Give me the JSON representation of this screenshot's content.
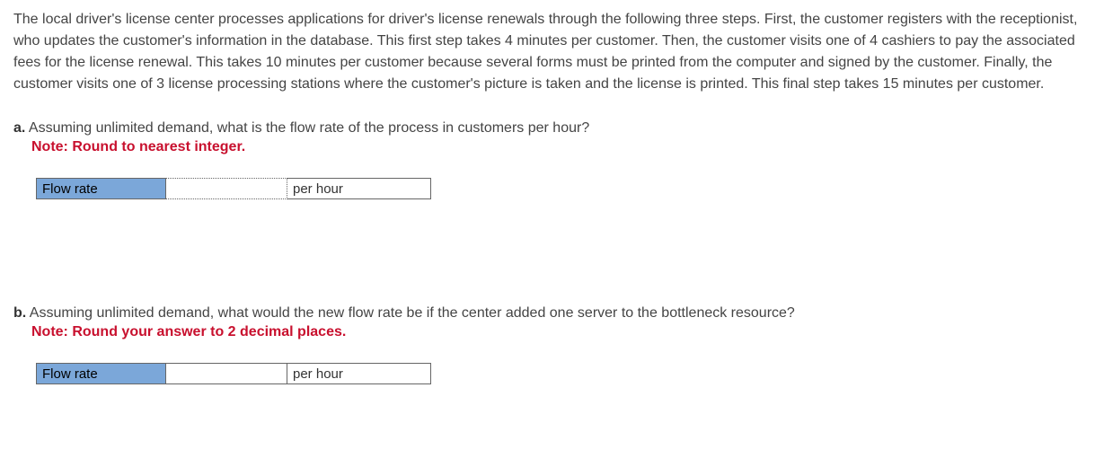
{
  "intro": "The local driver's license center processes applications for driver's license renewals through the following three steps. First, the customer registers with the receptionist, who updates the customer's information in the database. This first step takes 4 minutes per customer. Then, the customer visits one of 4 cashiers to pay the associated fees for the license renewal. This takes 10 minutes per customer because several forms must be printed from the computer and signed by the customer. Finally, the customer visits one of 3 license processing stations where the customer's picture is taken and the license is printed. This final step takes 15 minutes per customer.",
  "questions": {
    "a": {
      "letter": "a.",
      "text": "Assuming unlimited demand, what is the flow rate of the process in customers per hour?",
      "note": "Note: Round to nearest integer.",
      "label": "Flow rate",
      "unit": "per hour",
      "value": ""
    },
    "b": {
      "letter": "b.",
      "text": "Assuming unlimited demand, what would the new flow rate be if the center added one server to the bottleneck resource?",
      "note": "Note: Round your answer to 2 decimal places.",
      "label": "Flow rate",
      "unit": "per hour",
      "value": ""
    }
  }
}
